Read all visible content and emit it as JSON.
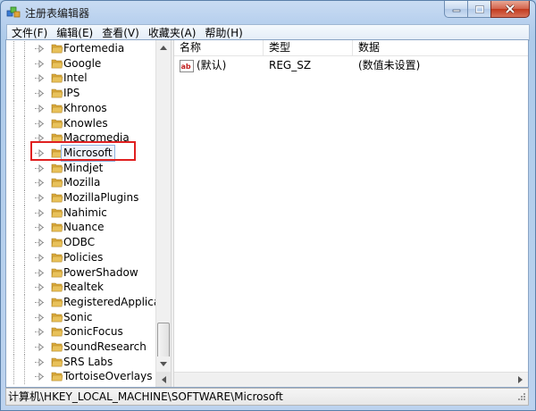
{
  "window": {
    "title": "注册表编辑器",
    "app_icon": "regedit-icon",
    "caption_buttons": [
      "minimize-icon",
      "maximize-icon",
      "close-icon"
    ]
  },
  "menu": [
    "文件(F)",
    "编辑(E)",
    "查看(V)",
    "收藏夹(A)",
    "帮助(H)"
  ],
  "tree": {
    "items": [
      "Fortemedia",
      "Google",
      "Intel",
      "IPS",
      "Khronos",
      "Knowles",
      "Macromedia",
      "Microsoft",
      "Mindjet",
      "Mozilla",
      "MozillaPlugins",
      "Nahimic",
      "Nuance",
      "ODBC",
      "Policies",
      "PowerShadow",
      "Realtek",
      "RegisteredApplications",
      "Sonic",
      "SonicFocus",
      "SoundResearch",
      "SRS Labs",
      "TortoiseOverlays"
    ],
    "selected": "Microsoft"
  },
  "list": {
    "columns": [
      "名称",
      "类型",
      "数据"
    ],
    "rows": [
      {
        "name": "(默认)",
        "type": "REG_SZ",
        "data": "(数值未设置)",
        "icon": "string-value-icon"
      }
    ]
  },
  "status": {
    "path": "计算机\\HKEY_LOCAL_MACHINE\\SOFTWARE\\Microsoft"
  },
  "colors": {
    "highlight": "#e02020",
    "folder": "#e8c15a",
    "selection": "#eef3fb"
  }
}
